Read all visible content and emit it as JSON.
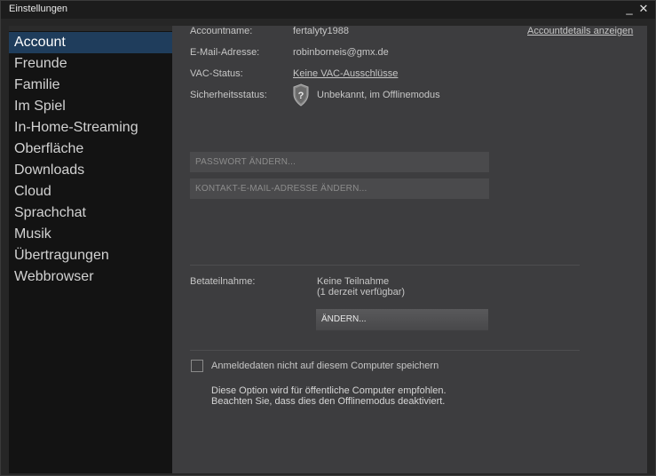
{
  "window": {
    "title": "Einstellungen",
    "minimize_icon": "minimize-icon",
    "close_icon": "close-icon"
  },
  "sidebar": {
    "items": [
      {
        "label": "Account",
        "active": true
      },
      {
        "label": "Freunde"
      },
      {
        "label": "Familie"
      },
      {
        "label": "Im Spiel"
      },
      {
        "label": "In-Home-Streaming"
      },
      {
        "label": "Oberfläche"
      },
      {
        "label": "Downloads"
      },
      {
        "label": "Cloud"
      },
      {
        "label": "Sprachchat"
      },
      {
        "label": "Musik"
      },
      {
        "label": "Übertragungen"
      },
      {
        "label": "Webbrowser"
      }
    ]
  },
  "account": {
    "name_label": "Accountname:",
    "name_value": "fertalyty1988",
    "details_link": "Accountdetails anzeigen",
    "email_label": "E-Mail-Adresse:",
    "email_value": "robinborneis@gmx.de",
    "vac_label": "VAC-Status:",
    "vac_value": "Keine VAC-Ausschlüsse",
    "security_label": "Sicherheitsstatus:",
    "security_value": "Unbekannt, im Offlinemodus",
    "security_icon": "shield-question-icon"
  },
  "actions": {
    "change_password": "PASSWORT ÄNDERN...",
    "change_email": "KONTAKT-E-MAIL-ADRESSE ÄNDERN..."
  },
  "beta": {
    "label": "Betateilnahme:",
    "value_line1": "Keine Teilnahme",
    "value_line2": "(1 derzeit verfügbar)",
    "change_button": "ÄNDERN..."
  },
  "login": {
    "checkbox_label": "Anmeldedaten nicht auf diesem Computer speichern",
    "checked": false,
    "note_line1": "Diese Option wird für öffentliche Computer empfohlen.",
    "note_line2": "Beachten Sie, dass dies den Offlinemodus deaktiviert."
  },
  "colors": {
    "accent_selected": "#1f3d5c",
    "panel": "#3d3d3f",
    "sidebar": "#131313"
  }
}
